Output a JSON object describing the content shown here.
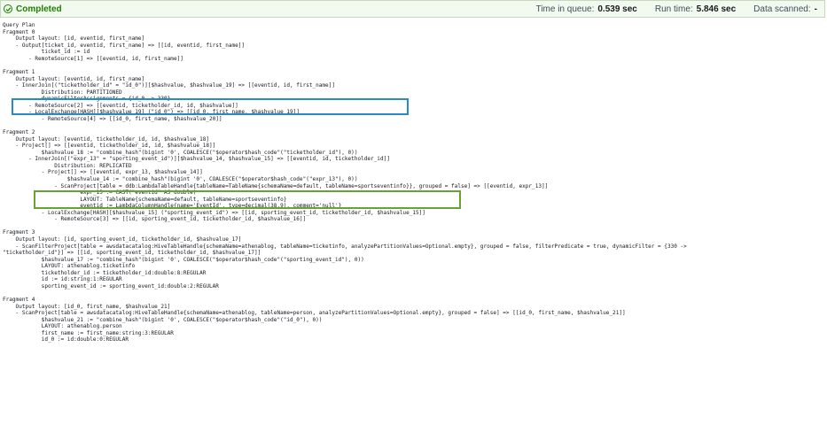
{
  "status": {
    "label": "Completed",
    "color": "#1d8102",
    "icon": "check-circle-icon",
    "time_in_queue_label": "Time in queue:",
    "time_in_queue_value": "0.539 sec",
    "run_time_label": "Run time:",
    "run_time_value": "5.846 sec",
    "data_scanned_label": "Data scanned:",
    "data_scanned_value": "-"
  },
  "highlights": {
    "blue": "#2b8ac4",
    "green": "#6aa136"
  },
  "plan": {
    "lines": [
      "Query Plan",
      "Fragment 0",
      "    Output layout: [id, eventid, first_name]",
      "    - Output[ticket_id, eventid, first_name] => [[id, eventid, first_name]]",
      "            ticket_id := id",
      "        - RemoteSource[1] => [[eventid, id, first_name]]",
      "",
      "Fragment 1",
      "    Output layout: [eventid, id, first_name]",
      "    - InnerJoin[(\"ticketholder_id\" = \"id_0\")][$hashvalue, $hashvalue_19] => [[eventid, id, first_name]]",
      "            Distribution: PARTITIONED",
      "            dynamicFilterAssignments = {id_0 -> 330}",
      "        - RemoteSource[2] => [[eventid, ticketholder_id, id, $hashvalue]]",
      "        - LocalExchange[HASH][$hashvalue_19] (\"id_0\") => [[id_0, first_name, $hashvalue_19]]",
      "            - RemoteSource[4] => [[id_0, first_name, $hashvalue_20]]",
      "",
      "Fragment 2",
      "    Output layout: [eventid, ticketholder_id, id, $hashvalue_18]",
      "    - Project[] => [[eventid, ticketholder_id, id, $hashvalue_18]]",
      "            $hashvalue_18 := \"combine_hash\"(bigint '0', COALESCE(\"$operator$hash_code\"(\"ticketholder_id\"), 0))",
      "        - InnerJoin[(\"expr_13\" = \"sporting_event_id\")][$hashvalue_14, $hashvalue_15] => [[eventid, id, ticketholder_id]]",
      "                Distribution: REPLICATED",
      "            - Project[] => [[eventid, expr_13, $hashvalue_14]]",
      "                    $hashvalue_14 := \"combine_hash\"(bigint '0', COALESCE(\"$operator$hash_code\"(\"expr_13\"), 0))",
      "                - ScanProject[table = ddb:LambdaTableHandle{tableName=TableName{schemaName=default, tableName=sportseventinfo}}, grouped = false] => [[eventid, expr_13]]",
      "                        expr_13 := CAST(\"eventid\" AS double)",
      "                        LAYOUT: TableName{schemaName=default, tableName=sportseventinfo}",
      "                        eventid := LambdaColumnHandle{name='EventId', type=decimal(38,9), comment='null'}",
      "            - LocalExchange[HASH][$hashvalue_15] (\"sporting_event_id\") => [[id, sporting_event_id, ticketholder_id, $hashvalue_15]]",
      "                - RemoteSource[3] => [[id, sporting_event_id, ticketholder_id, $hashvalue_16]]",
      "",
      "Fragment 3",
      "    Output layout: [id, sporting_event_id, ticketholder_id, $hashvalue_17]",
      "    - ScanFilterProject[table = awsdatacatalog:HiveTableHandle{schemaName=athenablog, tableName=ticketinfo, analyzePartitionValues=Optional.empty}, grouped = false, filterPredicate = true, dynamicFilter = {330 ->",
      "\"ticketholder_id\"}] => [[id, sporting_event_id, ticketholder_id, $hashvalue_17]]",
      "            $hashvalue_17 := \"combine_hash\"(bigint '0', COALESCE(\"$operator$hash_code\"(\"sporting_event_id\"), 0))",
      "            LAYOUT: athenablog.ticketinfo",
      "            ticketholder_id := ticketholder_id:double:8:REGULAR",
      "            id := id:string:1:REGULAR",
      "            sporting_event_id := sporting_event_id:double:2:REGULAR",
      "",
      "Fragment 4",
      "    Output layout: [id_0, first_name, $hashvalue_21]",
      "    - ScanProject[table = awsdatacatalog:HiveTableHandle{schemaName=athenablog, tableName=person, analyzePartitionValues=Optional.empty}, grouped = false] => [[id_0, first_name, $hashvalue_21]]",
      "            $hashvalue_21 := \"combine_hash\"(bigint '0', COALESCE(\"$operator$hash_code\"(\"id_0\"), 0))",
      "            LAYOUT: athenablog.person",
      "            first_name := first_name:string:3:REGULAR",
      "            id_0 := id:double:0:REGULAR"
    ]
  }
}
